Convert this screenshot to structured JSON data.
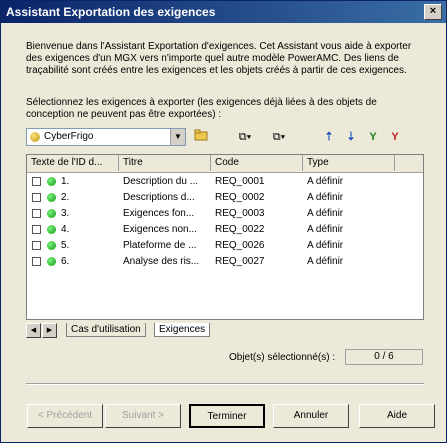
{
  "window": {
    "title": "Assistant Exportation des exigences",
    "close_label": "×"
  },
  "intro_text": "Bienvenue dans l'Assistant Exportation d'exigences. Cet Assistant vous aide à exporter des exigences d'un MGX vers n'importe quel autre modèle PowerAMC. Des liens de traçabilité sont créés entre les exigences et les objets créés à partir de ces exigences.",
  "instruction_text": "Sélectionnez les exigences à exporter (les exigences déjà liées à des objets de conception ne peuvent pas être exportées) :",
  "model_selector": {
    "value": "CyberFrigo",
    "arrow": "▼"
  },
  "toolbar": {
    "browse_icon": "folder-icon",
    "select_glyph": "⧉▾",
    "deselect_glyph": "⧉▾",
    "move_up_glyph": "⇡",
    "move_down_glyph": "⇣",
    "filter_glyph": "Y",
    "clear_filter_glyph": "Y"
  },
  "table": {
    "columns": [
      "Texte de l'ID d...",
      "Titre",
      "Code",
      "Type"
    ],
    "rows": [
      {
        "id": "1.",
        "title": "Description du ...",
        "code": "REQ_0001",
        "type": "A définir"
      },
      {
        "id": "2.",
        "title": "Descriptions d...",
        "code": "REQ_0002",
        "type": "A définir"
      },
      {
        "id": "3.",
        "title": "Exigences fon...",
        "code": "REQ_0003",
        "type": "A définir"
      },
      {
        "id": "4.",
        "title": "Exigences non...",
        "code": "REQ_0022",
        "type": "A définir"
      },
      {
        "id": "5.",
        "title": "Plateforme de ...",
        "code": "REQ_0026",
        "type": "A définir"
      },
      {
        "id": "6.",
        "title": "Analyse des ris...",
        "code": "REQ_0027",
        "type": "A définir"
      }
    ]
  },
  "tabs": [
    {
      "label": "Cas d'utilisation",
      "active": false
    },
    {
      "label": "Exigences",
      "active": true
    }
  ],
  "selection": {
    "label": "Objet(s) sélectionné(s) :",
    "count": "0 / 6"
  },
  "buttons": {
    "previous": "< Précédent",
    "next": "Suivant >",
    "finish": "Terminer",
    "cancel": "Annuler",
    "help": "Aide"
  }
}
